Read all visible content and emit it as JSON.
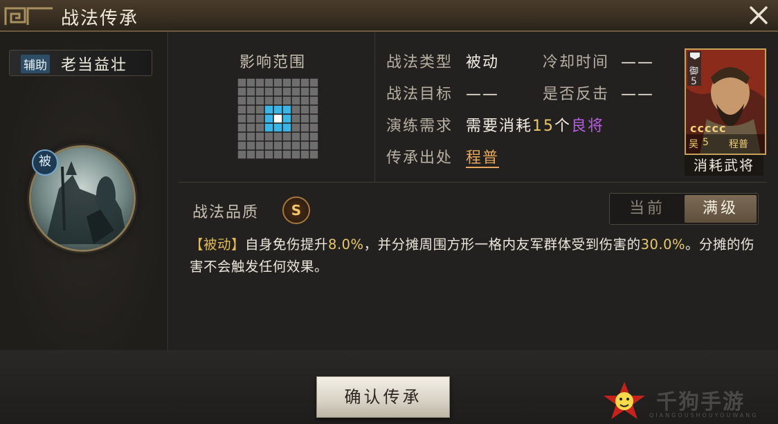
{
  "window": {
    "title": "战法传承"
  },
  "skill": {
    "type_badge": "辅助",
    "name": "老当益壮",
    "passive_badge": "被"
  },
  "range": {
    "title": "影响范围",
    "grid_size": 9,
    "center": [
      4,
      4
    ],
    "affected_radius": 1
  },
  "attributes": {
    "skill_type_label": "战法类型",
    "skill_type_value": "被动",
    "cooldown_label": "冷却时间",
    "cooldown_value": "——",
    "target_label": "战法目标",
    "target_value": "——",
    "counter_label": "是否反击",
    "counter_value": "——",
    "train_label": "演练需求",
    "train_prefix": "需要消耗",
    "train_count": "15",
    "train_unit": "个",
    "train_grade": "良将",
    "source_label": "传承出处",
    "source_value": "程普"
  },
  "card": {
    "corner_top": "御",
    "corner_num": "5",
    "coins": "ccccc",
    "faction": "吴",
    "cost": "5",
    "general": "程普",
    "footer": "消耗武将"
  },
  "quality": {
    "label": "战法品质",
    "grade": "S"
  },
  "toggle": {
    "current": "当前",
    "max": "满级"
  },
  "description": {
    "tag": "【被动】",
    "part1": "自身免伤提升",
    "v1": "8.0%",
    "part2": "，并分摊周围方形一格内友军群体受到伤害的",
    "v2": "30.0%",
    "part3": "。分摊的伤害不会触发任何效果。"
  },
  "actions": {
    "confirm": "确认传承"
  },
  "watermark": {
    "text": "千狗手游",
    "sub": "QIANGOUSHOUYOUWANG"
  },
  "colors": {
    "accent_gold": "#e9c96b",
    "grade_purple": "#b65de0",
    "source_orange": "#e8a85a",
    "grid_blue": "#39b6e6"
  }
}
